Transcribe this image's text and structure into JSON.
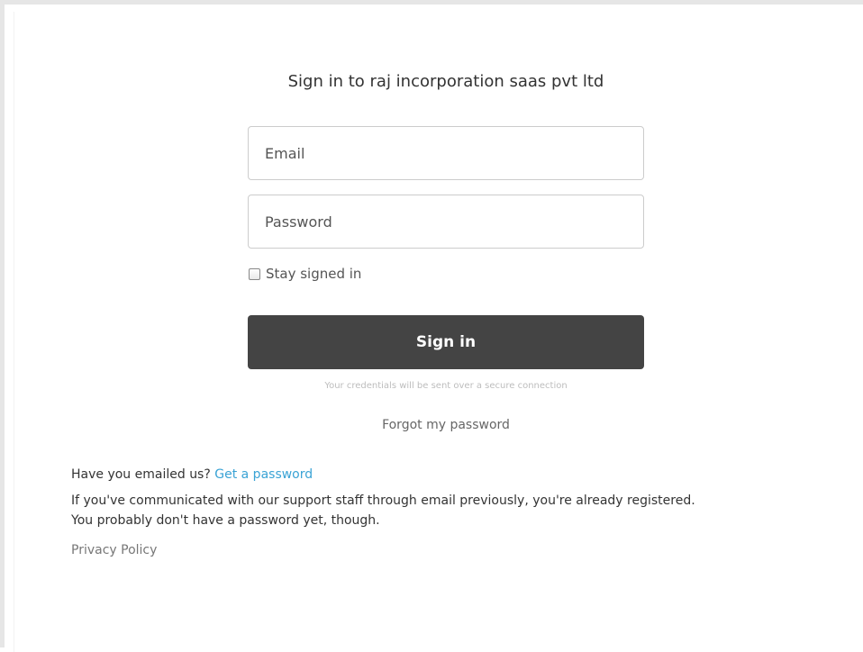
{
  "page": {
    "title": "Sign in to raj incorporation saas pvt ltd"
  },
  "form": {
    "email_placeholder": "Email",
    "password_placeholder": "Password",
    "stay_signed_in_label": "Stay signed in",
    "stay_signed_in_checked": false,
    "signin_label": "Sign in",
    "secure_note": "Your credentials will be sent over a secure connection",
    "forgot_label": "Forgot my password"
  },
  "footer": {
    "question": "Have you emailed us?",
    "get_password_link": "Get a password",
    "info_line1": "If you've communicated with our support staff through email previously, you're already registered.",
    "info_line2": "You probably don't have a password yet, though.",
    "privacy_link": "Privacy Policy"
  },
  "colors": {
    "button_bg": "#444444",
    "link": "#3aa3d5",
    "border": "#cccccc"
  }
}
